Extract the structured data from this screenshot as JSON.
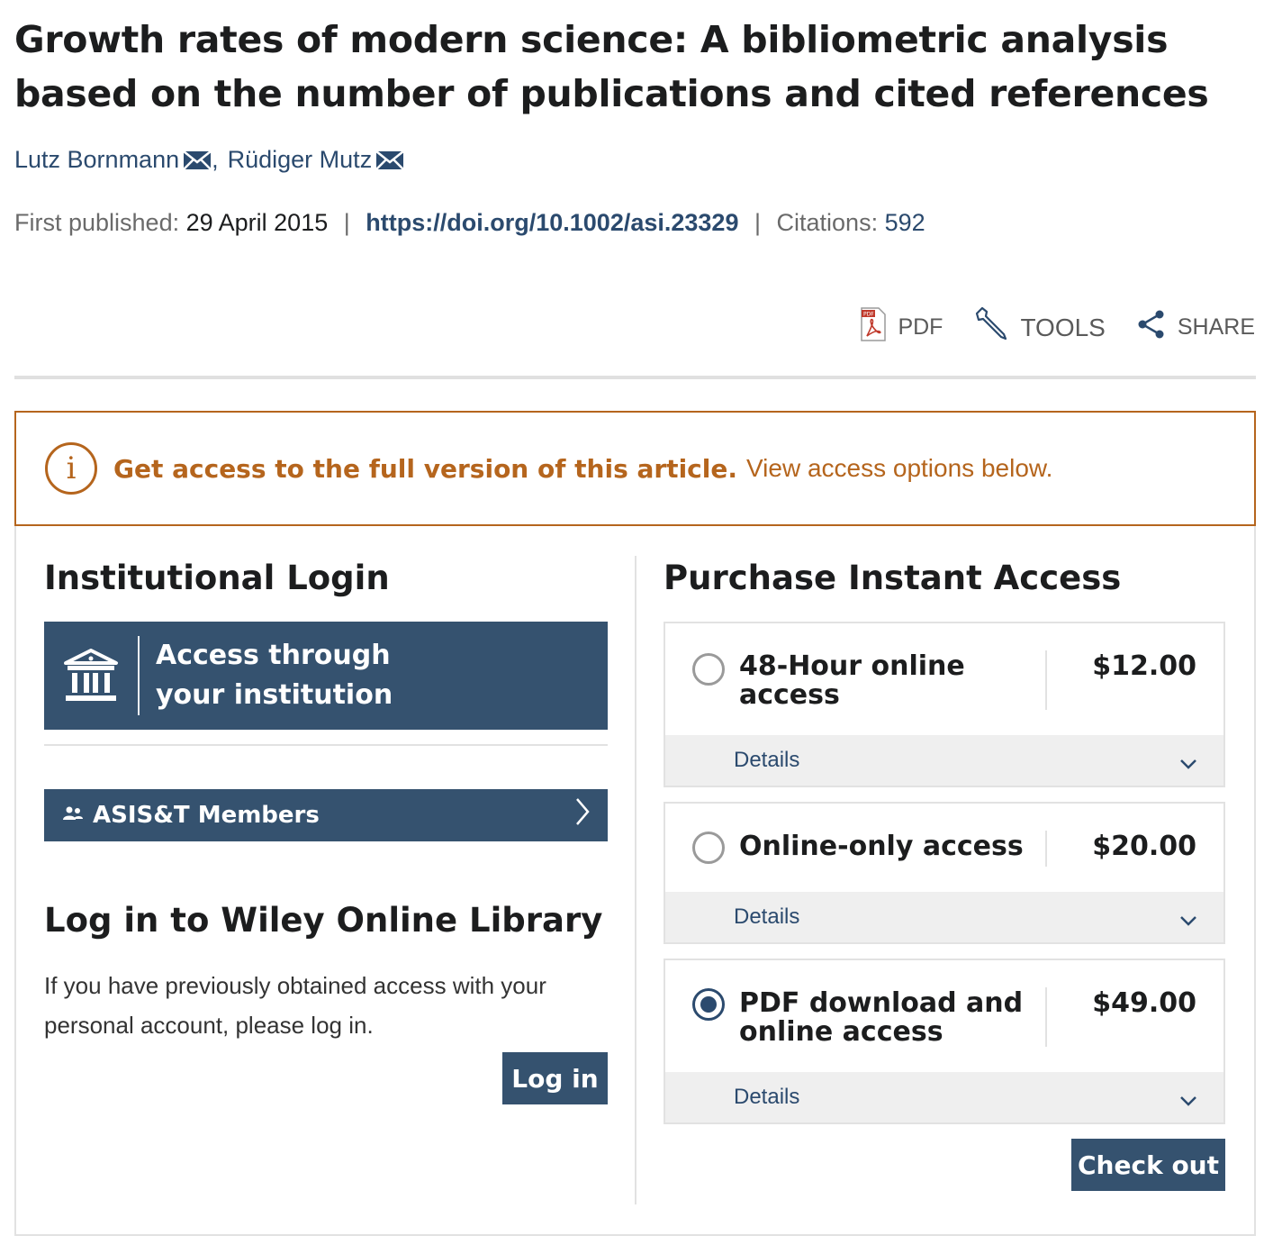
{
  "article": {
    "title": "Growth rates of modern science: A bibliometric analysis based on the number of publications and cited references",
    "authors": [
      {
        "name": "Lutz Bornmann"
      },
      {
        "name": "Rüdiger Mutz"
      }
    ],
    "author_sep": ",",
    "first_published_label": "First published:",
    "first_published_date": "29 April 2015",
    "doi": "https://doi.org/10.1002/asi.23329",
    "citations_label": "Citations:",
    "citations_count": "592"
  },
  "toolbar": {
    "pdf_label": "PDF",
    "tools_label": "TOOLS",
    "share_label": "SHARE"
  },
  "alert": {
    "strong": "Get access to the full version of this article.",
    "light": "View access options below."
  },
  "institutional": {
    "heading": "Institutional Login",
    "access_button": "Access through your institution",
    "members_button": "ASIS&T Members"
  },
  "wiley_login": {
    "heading": "Log in to Wiley Online Library",
    "text": "If you have previously obtained access with your personal account, please log in.",
    "button": "Log in"
  },
  "purchase": {
    "heading": "Purchase Instant Access",
    "options": [
      {
        "name": "48-Hour online access",
        "price": "$12.00",
        "details": "Details",
        "selected": false
      },
      {
        "name": "Online-only access",
        "price": "$20.00",
        "details": "Details",
        "selected": false
      },
      {
        "name": "PDF download and online access",
        "price": "$49.00",
        "details": "Details",
        "selected": true
      }
    ],
    "checkout_button": "Check out"
  },
  "colors": {
    "link": "#2b4a6e",
    "button": "#35526f",
    "alert": "#b5651d",
    "border": "#e2e2e2"
  },
  "icons": [
    "mail-icon",
    "pdf-icon",
    "wrench-icon",
    "share-icon",
    "info-icon",
    "bank-icon",
    "people-icon",
    "chevron-right-icon",
    "chevron-down-icon"
  ]
}
